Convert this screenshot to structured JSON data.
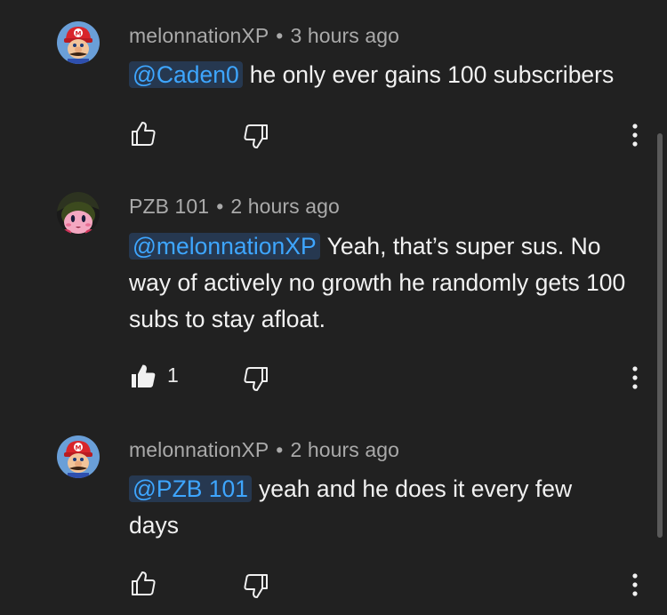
{
  "comments": [
    {
      "author": "melonnationXP",
      "separator": "•",
      "time": "3 hours ago",
      "mention": "@Caden0",
      "text": "he only ever gains 100 subscribers",
      "likes": "",
      "avatar_icon": "mario-avatar-icon",
      "liked": false
    },
    {
      "author": "PZB 101",
      "separator": "•",
      "time": "2 hours ago",
      "mention": "@melonnationXP",
      "text": "Yeah, that’s super sus. No way of actively no growth he randomly gets 100 subs to stay afloat.",
      "likes": "1",
      "avatar_icon": "kirby-avatar-icon",
      "liked": true
    },
    {
      "author": "melonnationXP",
      "separator": "•",
      "time": "2 hours ago",
      "mention": "@PZB 101",
      "text": "yeah and he does it every few days",
      "likes": "",
      "avatar_icon": "mario-avatar-icon",
      "liked": false
    }
  ],
  "colors": {
    "background": "#212121",
    "text": "#f1f1f1",
    "meta": "#aaaaaa",
    "mention": "#3ea6ff",
    "mention_bg": "#263850"
  }
}
